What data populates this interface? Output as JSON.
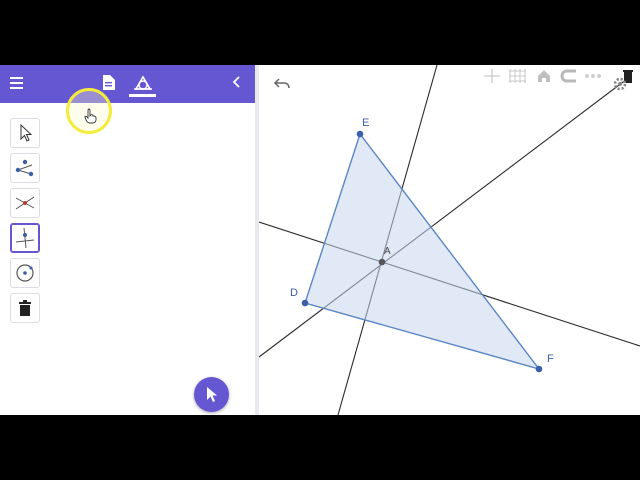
{
  "header": {
    "menu_icon": "hamburger-icon",
    "algebra_tab_icon": "document-icon",
    "tools_tab_icon": "geometry-tools-icon",
    "collapse_icon": "chevron-left-icon",
    "accent_color": "#6557d2"
  },
  "tools": [
    {
      "icon": "move-arrow-icon"
    },
    {
      "icon": "point-segment-icon"
    },
    {
      "icon": "intersect-icon"
    },
    {
      "icon": "perpendicular-line-icon",
      "selected": true
    },
    {
      "icon": "circle-with-center-icon"
    },
    {
      "icon": "delete-icon"
    }
  ],
  "fab": {
    "icon": "cursor-arrow-icon"
  },
  "graphics": {
    "undo_icon": "undo-icon",
    "toolbar_icons": [
      "axes-icon",
      "grid-icon",
      "home-icon",
      "magnet-icon",
      "more-icon",
      "delete-icon"
    ],
    "settings_icon": "gear-icon",
    "points": {
      "E": {
        "label": "E"
      },
      "D": {
        "label": "D"
      },
      "F": {
        "label": "F"
      },
      "A": {
        "label": "A"
      }
    },
    "triangle_fill": "#c8d7ee",
    "triangle_stroke": "#5b86c6"
  }
}
